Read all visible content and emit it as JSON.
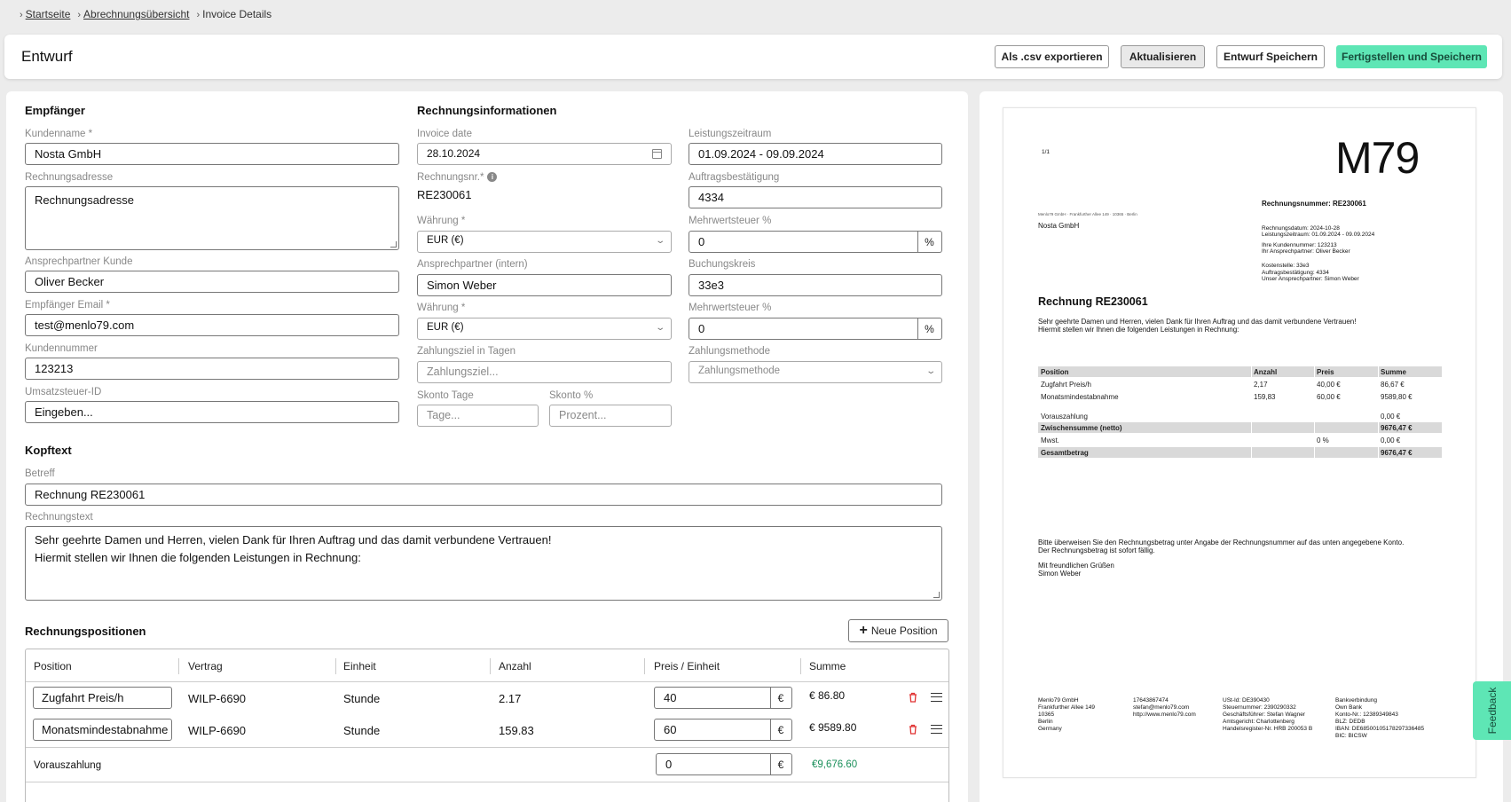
{
  "breadcrumb": {
    "home": "Startseite",
    "overview": "Abrechnungsübersicht",
    "current": "Invoice Details"
  },
  "header": {
    "title": "Entwurf",
    "btn_csv": "Als .csv exportieren",
    "btn_refresh": "Aktualisieren",
    "btn_save_draft": "Entwurf Speichern",
    "btn_finish": "Fertigstellen und Speichern"
  },
  "recipient": {
    "heading": "Empfänger",
    "name_label": "Kundenname *",
    "name_value": "Nosta GmbH",
    "address_label": "Rechnungsadresse",
    "address_placeholder": "Rechnungsadresse",
    "contact_label": "Ansprechpartner Kunde",
    "contact_value": "Oliver Becker",
    "email_label": "Empfänger Email *",
    "email_value": "test@menlo79.com",
    "customer_no_label": "Kundennummer",
    "customer_no_value": "123213",
    "vat_id_label": "Umsatzsteuer-ID",
    "vat_id_placeholder": "Eingeben..."
  },
  "invoice_info": {
    "heading": "Rechnungsinformationen",
    "date_label": "Invoice date",
    "date_value": "28.10.2024",
    "period_label": "Leistungszeitraum",
    "period_value": "01.09.2024 - 09.09.2024",
    "number_label": "Rechnungsnr.*",
    "number_value": "RE230061",
    "order_label": "Auftragsbestätigung",
    "order_value": "4334",
    "currency_label": "Währung *",
    "currency_value": "EUR (€)",
    "vat_label": "Mehrwertsteuer %",
    "vat_value": "0",
    "vat_suffix": "%",
    "contact_internal_label": "Ansprechpartner (intern)",
    "contact_internal_value": "Simon Weber",
    "cost_center_label": "Buchungskreis",
    "cost_center_value": "33e3",
    "currency2_label": "Währung *",
    "currency2_value": "EUR (€)",
    "vat2_label": "Mehrwertsteuer %",
    "vat2_value": "0",
    "vat2_suffix": "%",
    "payment_term_label": "Zahlungsziel in Tagen",
    "payment_term_placeholder": "Zahlungsziel...",
    "payment_method_label": "Zahlungsmethode",
    "payment_method_placeholder": "Zahlungsmethode",
    "discount_days_label": "Skonto Tage",
    "discount_days_placeholder": "Tage...",
    "discount_pct_label": "Skonto %",
    "discount_pct_placeholder": "Prozent..."
  },
  "header_text": {
    "heading": "Kopftext",
    "subject_label": "Betreff",
    "subject_value": "Rechnung RE230061",
    "body_label": "Rechnungstext",
    "body_line1": "Sehr geehrte Damen und Herren, vielen Dank für Ihren Auftrag und das damit verbundene Vertrauen!",
    "body_line2": "Hiermit stellen wir Ihnen die folgenden Leistungen in Rechnung:"
  },
  "positions": {
    "heading": "Rechnungspositionen",
    "new_button": "Neue Position",
    "columns": [
      "Position",
      "Vertrag",
      "Einheit",
      "Anzahl",
      "Preis / Einheit",
      "Summe"
    ],
    "rows": [
      {
        "position": "Zugfahrt Preis/h",
        "contract": "WILP-6690",
        "unit": "Stunde",
        "qty": "2.17",
        "price": "40",
        "currency": "€",
        "sum": "€ 86.80"
      },
      {
        "position": "Monatsmindestabnahme",
        "contract": "WILP-6690",
        "unit": "Stunde",
        "qty": "159.83",
        "price": "60",
        "currency": "€",
        "sum": "€ 9589.80"
      }
    ],
    "prepayment_label": "Vorauszahlung",
    "prepayment_value": "0",
    "prepayment_currency": "€",
    "total": "€9,676.60"
  },
  "preview": {
    "page": "1/1",
    "logo": "M79",
    "sender_line": "Menlo79 GmbH · Frankfurther Allee 149 · 10365 · Berlin",
    "recipient": "Nosta GmbH",
    "invoice_number": "Rechnungsnummer: RE230061",
    "meta": [
      "Rechnungsdatum: 2024-10-28",
      "Leistungszeitraum: 01.09.2024 - 09.09.2024",
      "Ihre Kundennummer: 123213",
      "Ihr Ansprechpartner: Oliver Becker",
      "Kostenstelle: 33e3",
      "Auftragsbestätigung: 4334",
      "Unser Ansprechpartner: Simon Weber"
    ],
    "title": "Rechnung RE230061",
    "intro1": "Sehr geehrte Damen und Herren, vielen Dank für Ihren Auftrag und das damit verbundene Vertrauen!",
    "intro2": "Hiermit stellen wir Ihnen die folgenden Leistungen in Rechnung:",
    "table_head": [
      "Position",
      "Anzahl",
      "Preis",
      "Summe"
    ],
    "table_rows": [
      [
        "Zugfahrt Preis/h",
        "2,17",
        "40,00 €",
        "86,67 €"
      ],
      [
        "Monatsmindestabnahme",
        "159,83",
        "60,00 €",
        "9589,80 €"
      ]
    ],
    "prepayment": [
      "Vorauszahlung",
      "0,00 €"
    ],
    "subtotal": [
      "Zwischensumme (netto)",
      "9676,47 €"
    ],
    "vat": [
      "Mwst.",
      "0 %",
      "0,00 €"
    ],
    "total": [
      "Gesamtbetrag",
      "9676,47 €"
    ],
    "closing1": "Bitte überweisen Sie den Rechnungsbetrag unter Angabe der Rechnungsnummer auf das unten angegebene Konto.",
    "closing2": "Der Rechnungsbetrag ist sofort fällig.",
    "greeting": "Mit freundlichen Grüßen",
    "signature": "Simon Weber",
    "footer_col1": [
      "Menlo79 GmbH",
      "Frankfurther Allee 149",
      "10365",
      "Berlin",
      "Germany"
    ],
    "footer_col2": [
      "17643867474",
      "stefan@menlo79.com",
      "http://www.menlo79.com"
    ],
    "footer_col3": [
      "USt-Id: DE390430",
      "Steuernummer: 2390290332",
      "Geschäftsführer: Stefan Wagner",
      "Amtsgericht: Charlottenberg",
      "Handelsregister-Nr. HRB 200053 B"
    ],
    "footer_col4": [
      "Bankverbindung",
      "Own Bank",
      "Konto-Nr.: 12389349843",
      "BLZ: DEDB",
      "IBAN: DE68500105178297336485",
      "BIC: BICSW"
    ]
  },
  "feedback": "Feedback"
}
